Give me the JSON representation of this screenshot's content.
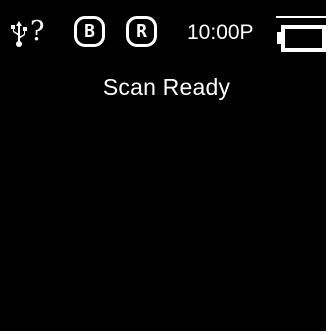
{
  "status_bar": {
    "usb_status": "?",
    "badges": [
      {
        "label": "B",
        "icon": "b-badge"
      },
      {
        "label": "R",
        "icon": "r-badge"
      }
    ],
    "time": "10:00P",
    "battery": {
      "icon": "battery-icon",
      "level_fraction": 0.15
    }
  },
  "main": {
    "status": "Scan Ready"
  },
  "colors": {
    "background": "#000000",
    "foreground": "#ffffff"
  }
}
